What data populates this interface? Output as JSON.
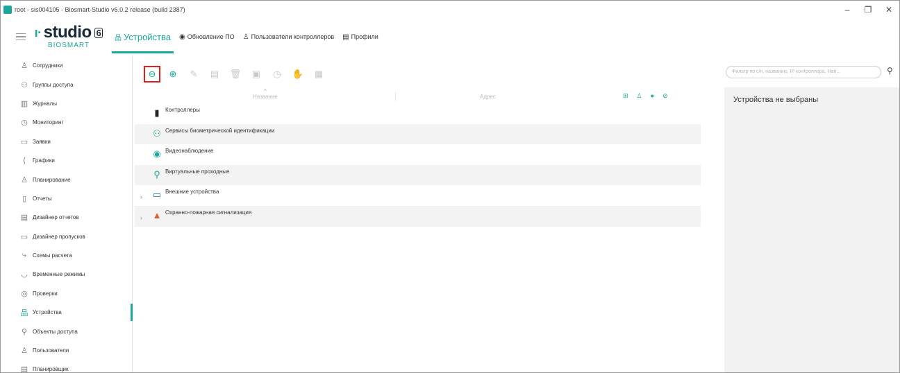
{
  "window": {
    "title": "root - sis004105 - Biosmart-Studio v6.0.2 release (build 2387)",
    "controls": {
      "minimize": "–",
      "maximize": "❐",
      "close": "✕"
    }
  },
  "logo": {
    "studio": "studio",
    "version": "6",
    "brand": "BIOSMART"
  },
  "nav": {
    "tabs": [
      {
        "label": "Устройства",
        "icon": "devices-icon",
        "active": true
      },
      {
        "label": "Обновление ПО",
        "icon": "update-icon",
        "active": false
      },
      {
        "label": "Пользователи контроллеров",
        "icon": "user-icon",
        "active": false
      },
      {
        "label": "Профили",
        "icon": "profile-icon",
        "active": false
      }
    ]
  },
  "sidebar": {
    "items": [
      {
        "label": "Сотрудники",
        "icon": "person-icon"
      },
      {
        "label": "Группы доступа",
        "icon": "group-icon"
      },
      {
        "label": "Журналы",
        "icon": "journal-icon"
      },
      {
        "label": "Мониторинг",
        "icon": "monitoring-icon"
      },
      {
        "label": "Заявки",
        "icon": "requests-icon"
      },
      {
        "label": "Графики",
        "icon": "schedule-icon"
      },
      {
        "label": "Планирование",
        "icon": "planning-icon"
      },
      {
        "label": "Отчеты",
        "icon": "reports-icon"
      },
      {
        "label": "Дизайнер отчетов",
        "icon": "report-designer-icon"
      },
      {
        "label": "Дизайнер пропусков",
        "icon": "pass-designer-icon"
      },
      {
        "label": "Схемы расчета",
        "icon": "calc-scheme-icon"
      },
      {
        "label": "Временные режимы",
        "icon": "time-mode-icon"
      },
      {
        "label": "Проверки",
        "icon": "checks-icon"
      },
      {
        "label": "Устройства",
        "icon": "devices-icon",
        "active": true
      },
      {
        "label": "Объекты доступа",
        "icon": "access-objects-icon"
      },
      {
        "label": "Пользователи",
        "icon": "users-icon"
      },
      {
        "label": "Планировщик",
        "icon": "scheduler-icon"
      }
    ]
  },
  "toolbar": {
    "buttons": [
      {
        "name": "collapse-all-button",
        "icon": "⊖",
        "enabled": true,
        "highlighted": true
      },
      {
        "name": "add-button",
        "icon": "⊕",
        "enabled": true
      },
      {
        "name": "edit-button",
        "icon": "✎",
        "enabled": false
      },
      {
        "name": "copy-button",
        "icon": "▤",
        "enabled": false
      },
      {
        "name": "delete-button",
        "icon": "🗑",
        "enabled": false
      },
      {
        "name": "user-card-button",
        "icon": "▣",
        "enabled": false
      },
      {
        "name": "history-button",
        "icon": "◷",
        "enabled": false
      },
      {
        "name": "hand-button",
        "icon": "✋",
        "enabled": false
      },
      {
        "name": "grid-button",
        "icon": "▦",
        "enabled": false
      }
    ]
  },
  "table": {
    "columns": {
      "name": "Название",
      "address": "Адрес"
    },
    "rows": [
      {
        "label": "Контроллеры",
        "icon": "controller-icon",
        "glyph": "▮",
        "color": "#222222",
        "expandable": false
      },
      {
        "label": "Сервисы биометрической идентификации",
        "icon": "biometric-icon",
        "glyph": "⚇",
        "color": "#1aa89a",
        "expandable": false
      },
      {
        "label": "Видеонаблюдение",
        "icon": "camera-icon",
        "glyph": "◉",
        "color": "#1aa89a",
        "expandable": false
      },
      {
        "label": "Виртуальные проходные",
        "icon": "virtual-gate-icon",
        "glyph": "⚲",
        "color": "#1aa89a",
        "expandable": false
      },
      {
        "label": "Внешние устройства",
        "icon": "external-device-icon",
        "glyph": "▭",
        "color": "#1b6fa8",
        "expandable": true
      },
      {
        "label": "Охранно-пожарная сигнализация",
        "icon": "fire-alarm-icon",
        "glyph": "▲",
        "color": "#e05a2a",
        "expandable": true
      }
    ]
  },
  "filter": {
    "placeholder": "Фильтр по с/н, названию, IP контроллера, Нап..."
  },
  "details": {
    "empty_text": "Устройства не выбраны"
  },
  "colors": {
    "accent": "#1aa89a",
    "highlight": "#e02020"
  }
}
